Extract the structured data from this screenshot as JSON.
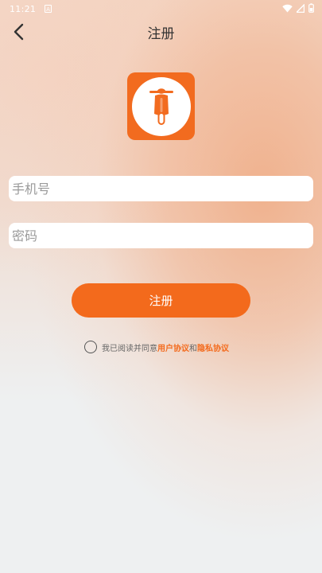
{
  "status_bar": {
    "time": "11:21",
    "app_icon": "A"
  },
  "header": {
    "title": "注册",
    "back_icon": "chevron-left-icon"
  },
  "logo": {
    "icon": "scooter-icon",
    "brand_color": "#f26b1f"
  },
  "form": {
    "phone_placeholder": "手机号",
    "phone_value": "",
    "password_placeholder": "密码",
    "password_value": ""
  },
  "register_button": {
    "label": "注册",
    "color": "#f36a1c"
  },
  "agreement": {
    "checked": false,
    "prefix": "我已阅读并同意",
    "user_agreement": "用户协议",
    "connector": "和",
    "privacy_policy": "隐私协议"
  }
}
